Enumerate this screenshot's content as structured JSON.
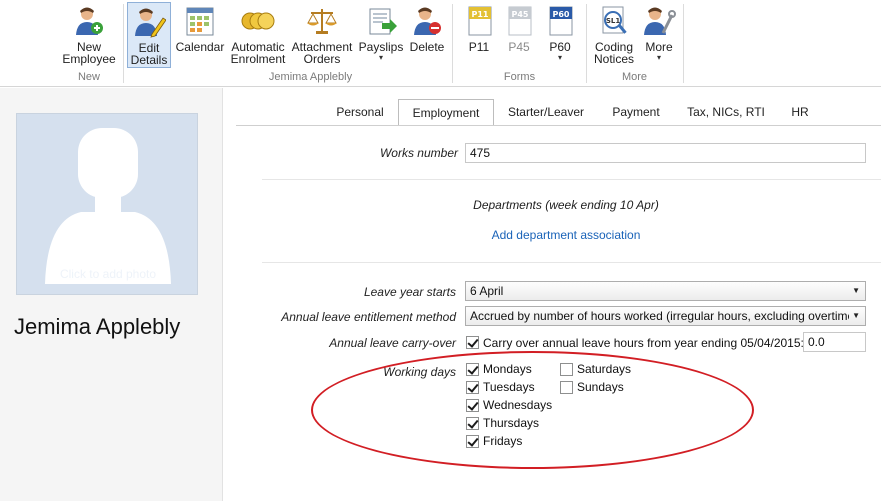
{
  "ribbon": {
    "groups": [
      {
        "label": "New",
        "buttons": [
          {
            "label1": "New",
            "label2": "Employee"
          }
        ]
      },
      {
        "label": "Jemima Applebly",
        "buttons": [
          {
            "label1": "Edit",
            "label2": "Details"
          },
          {
            "label1": "Calendar",
            "label2": ""
          },
          {
            "label1": "Automatic",
            "label2": "Enrolment"
          },
          {
            "label1": "Attachment",
            "label2": "Orders"
          },
          {
            "label1": "Payslips",
            "label2": "▾"
          },
          {
            "label1": "Delete",
            "label2": ""
          }
        ]
      },
      {
        "label": "Forms",
        "buttons": [
          {
            "label1": "P11",
            "label2": "",
            "badge": "P11"
          },
          {
            "label1": "P45",
            "label2": "",
            "badge": "P45"
          },
          {
            "label1": "P60",
            "label2": "▾",
            "badge": "P60"
          }
        ]
      },
      {
        "label": "More",
        "buttons": [
          {
            "label1": "Coding",
            "label2": "Notices",
            "badge": "SL1"
          },
          {
            "label1": "More",
            "label2": "▾"
          }
        ]
      }
    ]
  },
  "employee": {
    "name": "Jemima Applebly",
    "photo_hint": "Click to add photo"
  },
  "tabs": [
    "Personal",
    "Employment",
    "Starter/Leaver",
    "Payment",
    "Tax, NICs, RTI",
    "HR"
  ],
  "active_tab": "Employment",
  "form": {
    "works_number_label": "Works number",
    "works_number_value": "475",
    "departments_heading": "Departments (week ending 10 Apr)",
    "add_department_link": "Add department association",
    "leave_year_label": "Leave year starts",
    "leave_year_value": "6 April",
    "entitlement_label": "Annual leave entitlement method",
    "entitlement_value": "Accrued by number of hours worked (irregular hours, excluding overtime)",
    "carryover_label": "Annual leave carry-over",
    "carryover_text": "Carry over annual leave hours from year ending 05/04/2015:",
    "carryover_value": "0.0",
    "working_days_label": "Working days",
    "days": [
      {
        "name": "Mondays",
        "checked": true
      },
      {
        "name": "Tuesdays",
        "checked": true
      },
      {
        "name": "Wednesdays",
        "checked": true
      },
      {
        "name": "Thursdays",
        "checked": true
      },
      {
        "name": "Fridays",
        "checked": true
      },
      {
        "name": "Saturdays",
        "checked": false
      },
      {
        "name": "Sundays",
        "checked": false
      }
    ]
  },
  "colors": {
    "accent_link": "#1a63b8",
    "highlight_ellipse": "#d21e24",
    "active_button_bg": "#dbe8f7"
  }
}
